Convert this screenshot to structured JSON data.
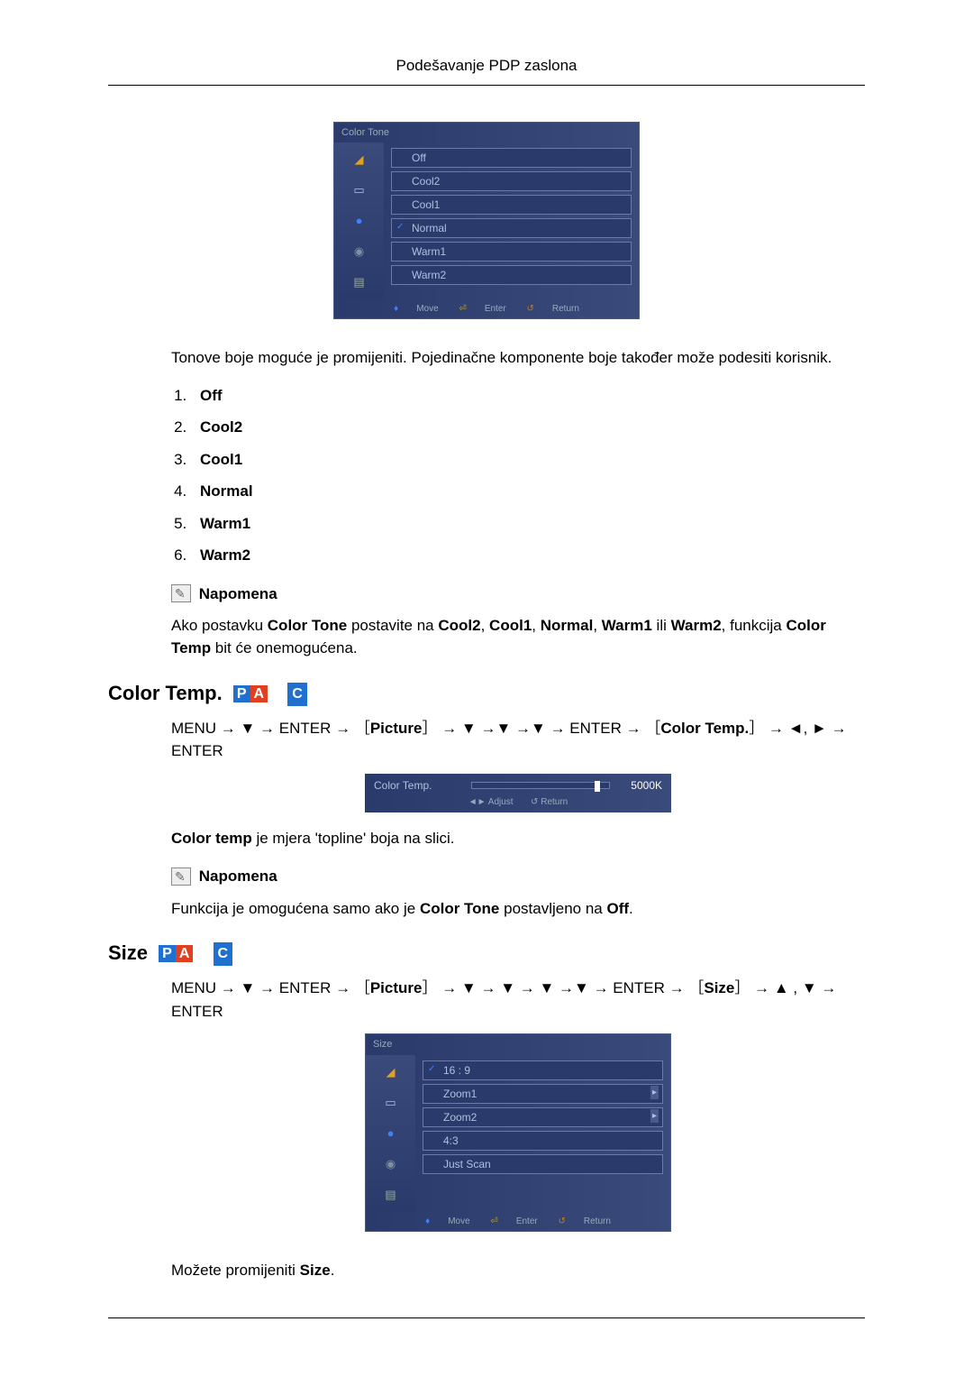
{
  "page_header": "Podešavanje PDP zaslona",
  "osd1": {
    "title": "Color Tone",
    "items": [
      "Off",
      "Cool2",
      "Cool1",
      "Normal",
      "Warm1",
      "Warm2"
    ],
    "selected_index": 3,
    "footer": {
      "move": "Move",
      "enter": "Enter",
      "return": "Return"
    }
  },
  "intro_para": "Tonove boje moguće je promijeniti. Pojedinačne komponente boje također može podesiti korisnik.",
  "tone_list": [
    "Off",
    "Cool2",
    "Cool1",
    "Normal",
    "Warm1",
    "Warm2"
  ],
  "note_label": "Napomena",
  "note1_pre": "Ako postavku ",
  "note1_b1": "Color Tone",
  "note1_mid1": " postavite na ",
  "note1_b2": "Cool2",
  "note1_c": ", ",
  "note1_b3": "Cool1",
  "note1_b4": "Normal",
  "note1_b5": "Warm1",
  "note1_or": " ili ",
  "note1_b6": "Warm2",
  "note1_post": ", funkcija ",
  "note1_b7": "Color Temp",
  "note1_end": " bit će onemogućena.",
  "section_colortemp": "Color Temp.",
  "nav_colortemp_parts": {
    "menu": "MENU → ▼ → ENTER → ［",
    "picture": "Picture",
    "mid": "］ → ▼ →▼ →▼ → ENTER → ［",
    "ct": "Color Temp.",
    "end": "］ → ◄, ► → ENTER"
  },
  "osd_slider": {
    "label": "Color Temp.",
    "value": "5000K",
    "adjust": "Adjust",
    "return": "Return"
  },
  "colortemp_desc_pre": "Color temp",
  "colortemp_desc_rest": " je mjera 'topline' boja na slici.",
  "note2_pre": "Funkcija je omogućena samo ako je ",
  "note2_b1": "Color Tone",
  "note2_mid": " postavljeno na ",
  "note2_b2": "Off",
  "note2_end": ".",
  "section_size": "Size",
  "nav_size_parts": {
    "menu": "MENU → ▼ → ENTER → ［",
    "picture": "Picture",
    "mid": "］ → ▼ → ▼ → ▼ →▼ → ENTER → ［",
    "size": "Size",
    "end": "］ → ▲ , ▼ → ENTER"
  },
  "osd2": {
    "title": "Size",
    "items": [
      "16 : 9",
      "Zoom1",
      "Zoom2",
      "4:3",
      "Just Scan"
    ],
    "selected_index": 0,
    "arrows": [
      1,
      2
    ],
    "footer": {
      "move": "Move",
      "enter": "Enter",
      "return": "Return"
    }
  },
  "size_desc_pre": "Možete promijeniti ",
  "size_desc_b": "Size",
  "size_desc_end": "."
}
